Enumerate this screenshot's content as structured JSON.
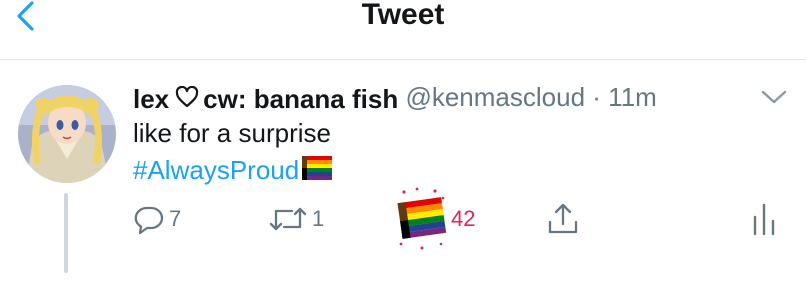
{
  "header": {
    "title": "Tweet",
    "accent_color": "#1da1f2"
  },
  "tweet": {
    "display_name": "lex",
    "name_heart_icon": "heart-outline-icon",
    "display_name_suffix": "cw: banana fish",
    "handle": "@kenmascloud",
    "separator": "·",
    "time": "11m",
    "text": "like for a surprise",
    "hashtag": "#AlwaysProud",
    "hashtag_icon": "rainbow-flag-icon",
    "actions": {
      "reply_count": "7",
      "retweet_count": "1",
      "like_count": "42",
      "like_icon": "rainbow-flag-icon",
      "like_color": "#e0245e"
    }
  }
}
